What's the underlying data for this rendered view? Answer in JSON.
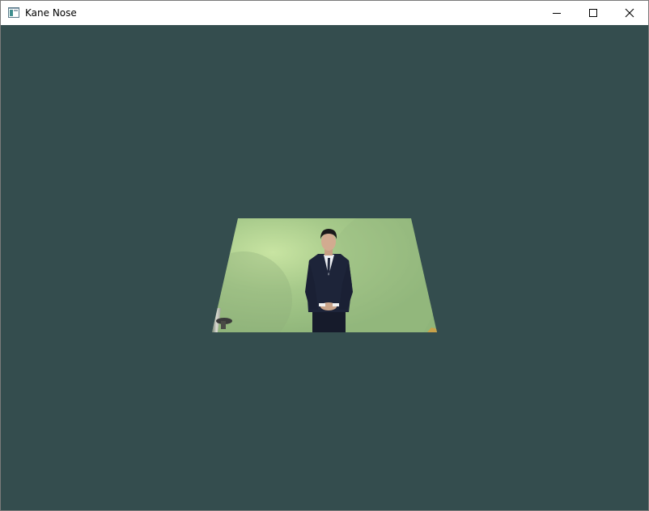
{
  "window": {
    "title": "Kane Nose",
    "icon": "app-window-icon",
    "background_color": "#344d4e"
  },
  "title_bar": {
    "minimize_icon": "minimize-icon",
    "maximize_icon": "maximize-icon",
    "close_icon": "close-icon"
  },
  "scene": {
    "description_icon": "video-frame",
    "wall_color": "#a9c98e",
    "suit_color": "#1c2236"
  }
}
